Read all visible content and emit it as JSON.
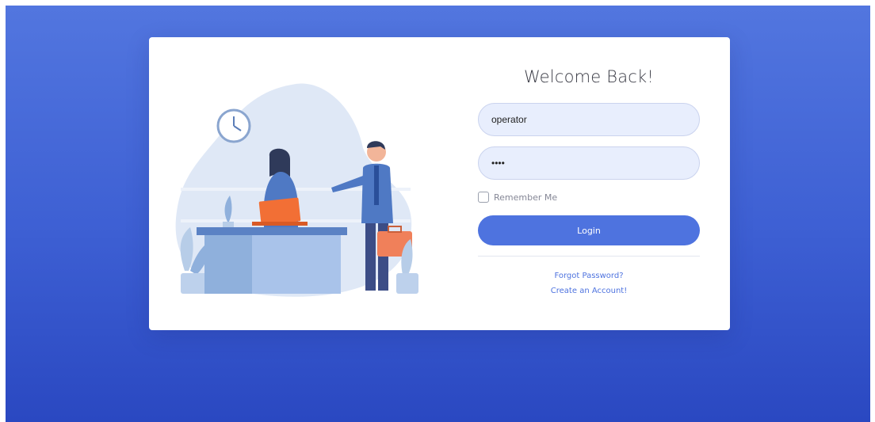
{
  "login": {
    "title": "Welcome Back!",
    "username_value": "operator",
    "password_value": "••••",
    "remember_label": "Remember Me",
    "login_label": "Login",
    "forgot_link": "Forgot Password?",
    "create_link": "Create an Account!"
  },
  "colors": {
    "primary": "#4e73df",
    "background_top": "#5276df",
    "background_bottom": "#2a48c1",
    "input_fill": "#e8eefd",
    "text_muted": "#858796"
  },
  "illustration": {
    "subject": "receptionist-and-businessman-icon"
  }
}
